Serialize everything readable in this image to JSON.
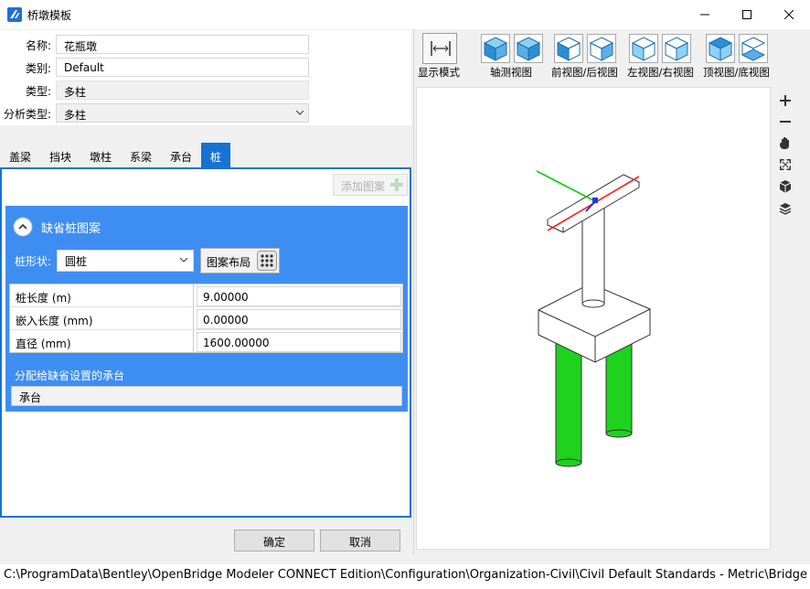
{
  "window": {
    "title": "桥墩模板"
  },
  "form": {
    "name_label": "名称:",
    "name_value": "花瓶墩",
    "category_label": "类别:",
    "category_value": "Default",
    "type_label": "类型:",
    "type_value": "多柱",
    "analysis_label": "分析类型:",
    "analysis_value": "多柱"
  },
  "tabs": [
    {
      "label": "盖梁"
    },
    {
      "label": "挡块"
    },
    {
      "label": "墩柱"
    },
    {
      "label": "系梁"
    },
    {
      "label": "承台"
    },
    {
      "label": "桩"
    }
  ],
  "active_tab": "桩",
  "pile": {
    "add_pattern_label": "添加图案",
    "section_title": "缺省桩图案",
    "shape_label": "桩形状:",
    "shape_value": "圆桩",
    "layout_button_label": "图案布局",
    "properties": [
      {
        "name": "桩长度 (m)",
        "value": "9.00000"
      },
      {
        "name": "嵌入长度 (mm)",
        "value": "0.00000"
      },
      {
        "name": "直径 (mm)",
        "value": "1600.00000"
      }
    ],
    "assign_label": "分配给缺省设置的承台",
    "assign_value": "承台"
  },
  "buttons": {
    "ok": "确定",
    "cancel": "取消"
  },
  "toolbar": {
    "display_mode": "显示模式",
    "axonometric": "轴测视图",
    "front_back": "前视图/后视图",
    "left_right": "左视图/右视图",
    "top_bottom": "顶视图/底视图"
  },
  "status": {
    "path": "C:\\ProgramData\\Bentley\\OpenBridge Modeler CONNECT Edition\\Configuration\\Organization-Civil\\Civil Default Standards - Metric\\Bridge Templates\\Pie"
  },
  "colors": {
    "accent": "#1673d1",
    "section_bg": "#3e8ef2",
    "pile_green": "#1ed21e"
  }
}
